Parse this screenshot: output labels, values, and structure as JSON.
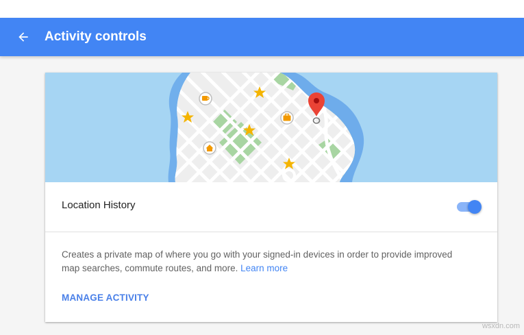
{
  "app_bar": {
    "title": "Activity controls",
    "back_icon": "arrow-back-icon",
    "color": "#4285f4"
  },
  "card": {
    "illustration": {
      "icons": [
        "map-pin-icon",
        "star-icon",
        "coffee-icon",
        "briefcase-icon",
        "home-icon"
      ],
      "water_color": "#a6d5f3",
      "land_color": "#eeeeee",
      "park_color": "#a8d5a2",
      "pin_color": "#ea4335",
      "star_color": "#f4b400"
    },
    "setting": {
      "label": "Location History",
      "toggle_on": true
    },
    "description": {
      "text": "Creates a private map of where you go with your signed-in devices in order to provide improved map searches, commute routes, and more.",
      "learn_more": "Learn more"
    },
    "manage_label": "MANAGE ACTIVITY",
    "accent": "#4285f4"
  },
  "watermark": "wsxdn.com"
}
